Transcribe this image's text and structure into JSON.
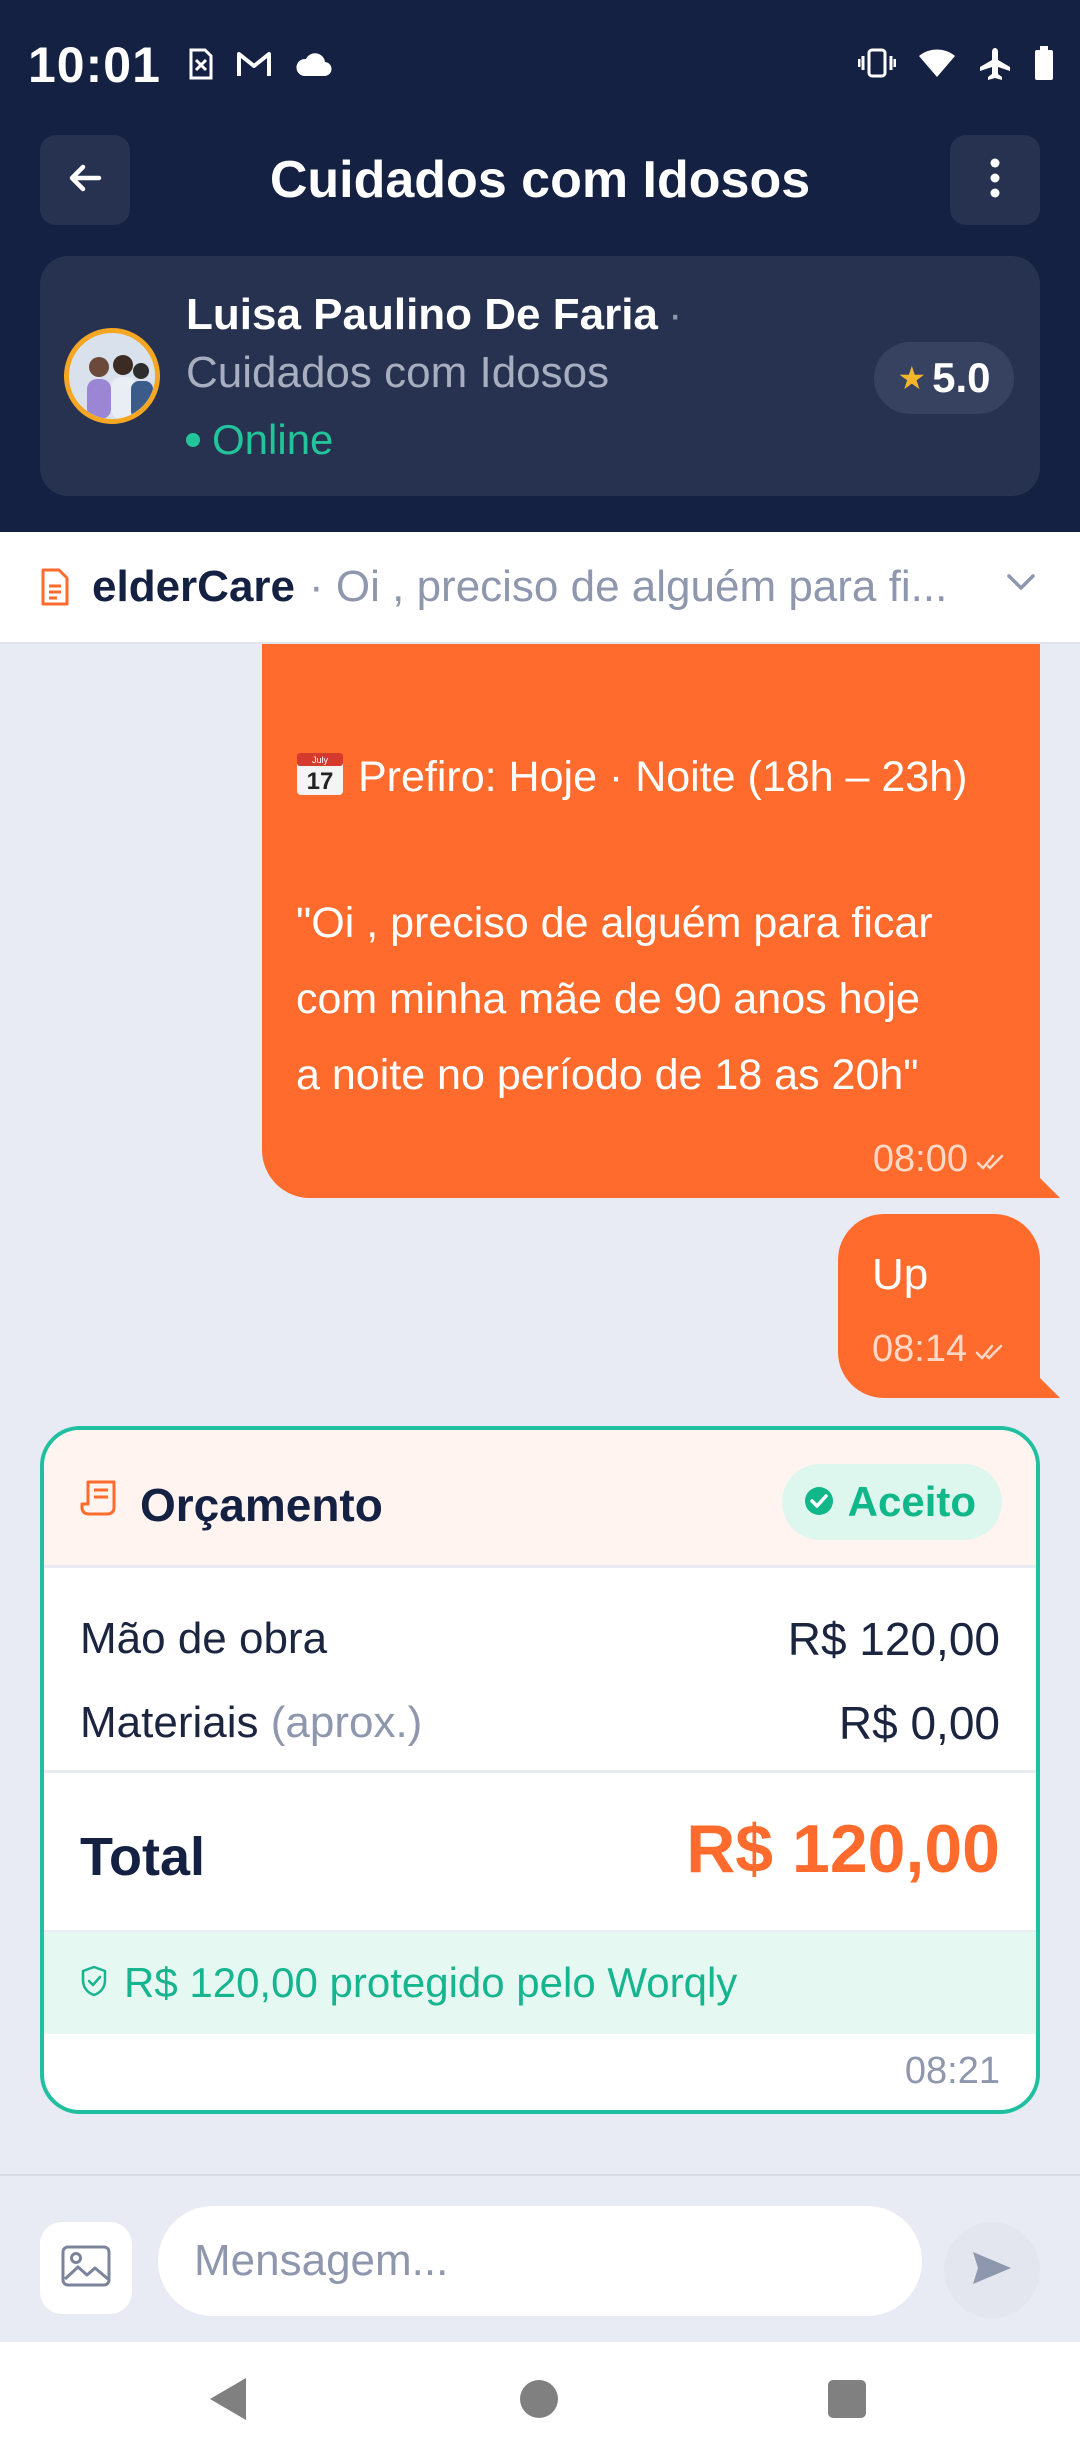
{
  "status_bar": {
    "time": "10:01",
    "left_icons": [
      "no-sim-icon",
      "gmail-icon",
      "cloud-icon"
    ],
    "right_icons": [
      "vibrate-icon",
      "wifi-icon",
      "airplane-icon",
      "battery-icon"
    ]
  },
  "app_bar": {
    "title": "Cuidados com Idosos",
    "back_icon": "arrow-left-icon",
    "menu_icon": "more-vertical-icon"
  },
  "profile": {
    "name": "Luisa Paulino De Faria",
    "separator": "·",
    "service": "Cuidados com Idosos",
    "status": "Online",
    "rating": "5.0"
  },
  "subject": {
    "title": "elderCare",
    "preview": "· Oi , preciso de alguém para fi..."
  },
  "messages": {
    "first": {
      "line_date": "Prefiro: Hoje · Noite (18h – 23h)",
      "calendar_day": "17",
      "calendar_month": "July",
      "quote_1": "\"Oi , preciso de alguém para ficar",
      "quote_2": "com minha mãe de 90 anos hoje",
      "quote_3": "a noite no período de 18 as 20h\"",
      "time": "08:00"
    },
    "second": {
      "text": "Up",
      "time": "08:14"
    }
  },
  "budget": {
    "title": "Orçamento",
    "status": "Aceito",
    "labor_label": "Mão de obra",
    "labor_value": "R$ 120,00",
    "materials_label": "Materiais",
    "materials_note": "(aprox.)",
    "materials_value": "R$ 0,00",
    "total_label": "Total",
    "total_value": "R$ 120,00",
    "protected_text": "R$ 120,00 protegido pelo Worqly",
    "time": "08:21"
  },
  "composer": {
    "placeholder": "Mensagem..."
  },
  "colors": {
    "header_bg": "#152143",
    "accent_orange": "#FF6B2C",
    "accent_green": "#1FBF9F",
    "chat_bg": "#E8EBF3"
  }
}
